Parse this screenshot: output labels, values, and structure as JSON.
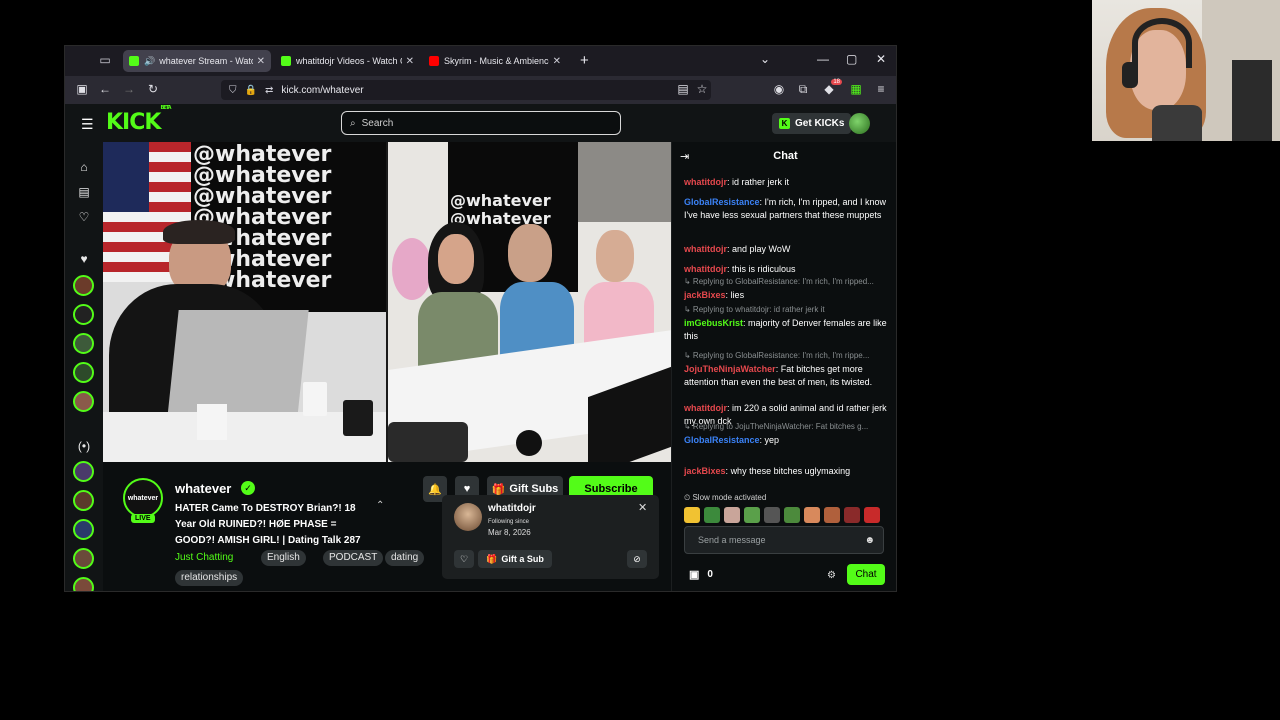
{
  "browser": {
    "tabs": [
      {
        "title": "whatever Stream - Watch Li",
        "active": true,
        "favicon": "kick-icon",
        "audio": true
      },
      {
        "title": "whatitdojr Videos - Watch On-D",
        "active": false,
        "favicon": "kick-icon"
      },
      {
        "title": "Skyrim - Music & Ambience - N",
        "active": false,
        "favicon": "youtube-icon"
      }
    ],
    "url": "kick.com/whatever",
    "extension_badge": "18"
  },
  "header": {
    "logo": "KICK",
    "logo_sup": "BETA",
    "search_placeholder": "Search",
    "get_kicks_label": "Get KICKs"
  },
  "channel": {
    "avatar_text": "whatever",
    "live_badge": "LIVE",
    "name": "whatever",
    "title": "HATER Came To DESTROY Brian?! 18 Year Old RUINED?! HØE PHASE = GOOD?! AMISH GIRL! | Dating Talk 287",
    "category": "Just Chatting",
    "tags": [
      "English",
      "PODCAST",
      "dating",
      "relationships"
    ],
    "gift_subs_label": "Gift Subs",
    "subscribe_label": "Subscribe"
  },
  "video": {
    "wall_text": "@whatever"
  },
  "user_card": {
    "username": "whatitdojr",
    "following_label": "Following since",
    "following_date": "Mar 8, 2026",
    "gift_label": "Gift a Sub"
  },
  "chat": {
    "title": "Chat",
    "messages": [
      {
        "reply": "",
        "user": "whatitdojr",
        "color": "#e5484d",
        "text": "id rather jerk it"
      },
      {
        "reply": "",
        "user": "GlobalResistance",
        "color": "#3b82f6",
        "text": "I'm rich, I'm ripped, and I know I've have less sexual partners that these muppets"
      },
      {
        "reply": "",
        "user": "whatitdojr",
        "color": "#e5484d",
        "text": "and play WoW"
      },
      {
        "reply": "",
        "user": "whatitdojr",
        "color": "#e5484d",
        "text": "this is ridiculous"
      },
      {
        "reply": "Replying to GlobalResistance: I'm rich, I'm ripped...",
        "user": "jackBixes",
        "color": "#e5484d",
        "text": "lies"
      },
      {
        "reply": "Replying to whatitdojr: id rather jerk it",
        "user": "imGebusKrist",
        "color": "#53fc18",
        "text": "majority of Denver females are like this"
      },
      {
        "reply": "Replying to GlobalResistance: I'm rich, I'm rippe...",
        "user": "JojuTheNinjaWatcher",
        "color": "#e5484d",
        "text": "Fat bitches get more attention than even the best of men, its twisted."
      },
      {
        "reply": "",
        "user": "whatitdojr",
        "color": "#e5484d",
        "text": "im 220 a solid animal and id rather jerk my own dck"
      },
      {
        "reply": "Replying to JojuTheNinjaWatcher: Fat bitches g...",
        "user": "GlobalResistance",
        "color": "#3b82f6",
        "text": "yep"
      },
      {
        "reply": "",
        "user": "jackBixes",
        "color": "#e5484d",
        "text": "why these bitches uglymaxing"
      }
    ],
    "slow_mode": "Slow mode activated",
    "input_placeholder": "Send a message",
    "points": "0",
    "send_label": "Chat"
  },
  "colors": {
    "accent": "#53fc18",
    "background": "#0b0e0f",
    "panel": "#111415"
  }
}
